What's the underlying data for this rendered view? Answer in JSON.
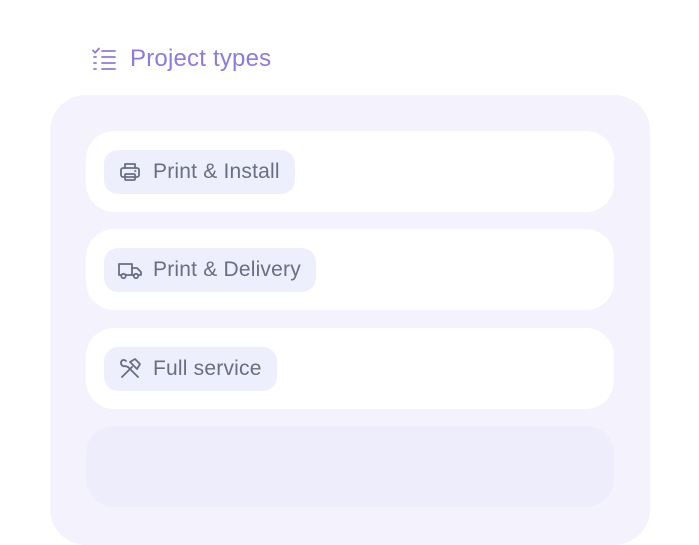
{
  "header": {
    "title": "Project types",
    "icon": "checklist-icon",
    "accent_color": "#8D7BE3"
  },
  "project_types": [
    {
      "label": "Print & Install",
      "icon": "printer-icon"
    },
    {
      "label": "Print & Delivery",
      "icon": "truck-icon"
    },
    {
      "label": "Full service",
      "icon": "tools-icon"
    }
  ],
  "colors": {
    "panel_background": "#F3F2FD",
    "card_background": "#FFFFFF",
    "chip_background": "#EEEFFD",
    "chip_text": "#6A6D84",
    "placeholder_background": "#EDEDFB"
  }
}
